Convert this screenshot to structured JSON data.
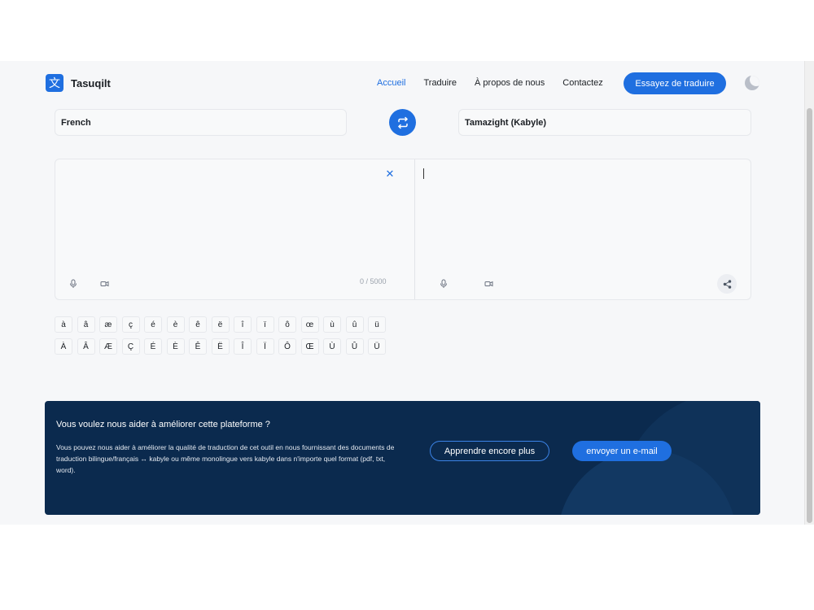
{
  "brand": {
    "logo_glyph": "文",
    "name": "Tasuqilt",
    "accent": "#1f6fe0"
  },
  "nav": {
    "items": [
      "Accueil",
      "Traduire",
      "À propos de nous",
      "Contactez"
    ],
    "cta_label": "Essayez de traduire"
  },
  "languages": {
    "source": "French",
    "target": "Tamazight (Kabyle)"
  },
  "editor": {
    "counter": "0 / 5000",
    "source_text": "",
    "target_text": ""
  },
  "special_chars": {
    "lowercase": [
      "à",
      "â",
      "æ",
      "ç",
      "é",
      "è",
      "ê",
      "ë",
      "î",
      "ï",
      "ô",
      "œ",
      "ù",
      "û",
      "ü"
    ],
    "uppercase": [
      "À",
      "Â",
      "Æ",
      "Ç",
      "É",
      "È",
      "Ê",
      "Ë",
      "Î",
      "Ï",
      "Ô",
      "Œ",
      "Ù",
      "Û",
      "Ü"
    ]
  },
  "banner": {
    "title": "Vous voulez nous aider à améliorer cette plateforme ?",
    "body": "Vous pouvez nous aider à améliorer la qualité de traduction de cet outil en nous fournissant des documents de traduction bilingue/français ↔ kabyle ou même monolingue vers kabyle dans n'importe quel format (pdf, txt, word).",
    "learn_label": "Apprendre encore plus",
    "email_label": "envoyer un e-mail",
    "background": "#0b2a4e"
  },
  "icons": {
    "swap": "swap-arrows-icon",
    "clear": "close-icon",
    "mic": "microphone-icon",
    "speaker": "speaker-icon",
    "share": "share-icon",
    "theme": "moon-icon"
  }
}
